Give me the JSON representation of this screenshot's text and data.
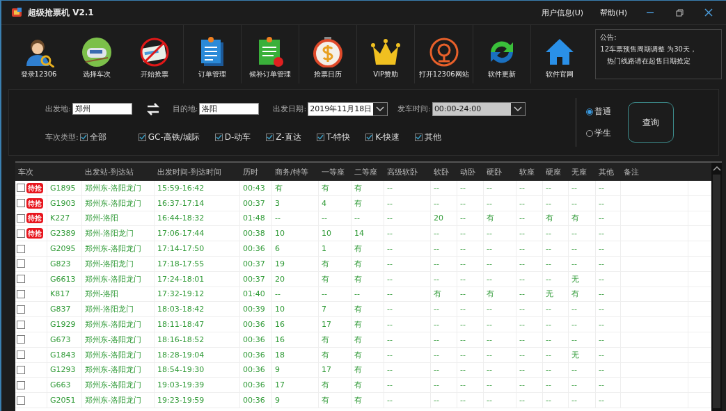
{
  "window": {
    "title": "超级抢票机 V2.1",
    "menu": [
      "用户信息(U)",
      "帮助(H)"
    ]
  },
  "toolbar": [
    {
      "label": "登录12306"
    },
    {
      "label": "选择车次"
    },
    {
      "label": "开始抢票"
    },
    {
      "label": "订单管理"
    },
    {
      "label": "候补订单管理"
    },
    {
      "label": "抢票日历"
    },
    {
      "label": "VIP赞助"
    },
    {
      "label": "打开12306网站"
    },
    {
      "label": "软件更新"
    },
    {
      "label": "软件官网"
    }
  ],
  "notice": {
    "title": "公告:",
    "lines": [
      "12车票预售周期调整  为30天，",
      "热门线路请在起售日期抢定"
    ]
  },
  "search": {
    "from_label": "出发地:",
    "from": "郑州",
    "to_label": "目的地:",
    "to": "洛阳",
    "date_label": "出发日期:",
    "date": "2019年11月18日",
    "time_label": "发车时间:",
    "time": "00:00-24:00",
    "type_label": "车次类型:",
    "types": [
      {
        "label": "全部",
        "checked": true
      },
      {
        "label": "GC-高铁/城际",
        "checked": true
      },
      {
        "label": "D-动车",
        "checked": true
      },
      {
        "label": "Z-直达",
        "checked": true
      },
      {
        "label": "T-特快",
        "checked": true
      },
      {
        "label": "K-快速",
        "checked": true
      },
      {
        "label": "其他",
        "checked": true
      }
    ],
    "passenger": [
      {
        "label": "普通",
        "selected": true
      },
      {
        "label": "学生",
        "selected": false
      }
    ],
    "query_button": "查询"
  },
  "table": {
    "columns": [
      "车次",
      "出发站-到达站",
      "出发时间-到达时间",
      "历时",
      "商务/特等",
      "一等座",
      "二等座",
      "高级软卧",
      "软卧",
      "动卧",
      "硬卧",
      "软座",
      "硬座",
      "无座",
      "其他",
      "备注"
    ],
    "rows": [
      {
        "checked": false,
        "badge": "待抢",
        "train": "G1895",
        "stations": "郑州东-洛阳龙门",
        "times": "15:59-16:42",
        "duration": "00:43",
        "seats": [
          "有",
          "有",
          "有",
          "--",
          "--",
          "--",
          "--",
          "--",
          "--",
          "--",
          "--"
        ]
      },
      {
        "checked": false,
        "badge": "待抢",
        "train": "G1903",
        "stations": "郑州东-洛阳龙门",
        "times": "16:37-17:14",
        "duration": "00:37",
        "seats": [
          "3",
          "4",
          "有",
          "--",
          "--",
          "--",
          "--",
          "--",
          "--",
          "--",
          "--"
        ]
      },
      {
        "checked": false,
        "badge": "待抢",
        "train": "K227",
        "stations": "郑州-洛阳",
        "times": "16:44-18:32",
        "duration": "01:48",
        "seats": [
          "--",
          "--",
          "--",
          "--",
          "20",
          "--",
          "有",
          "--",
          "有",
          "有",
          "--"
        ]
      },
      {
        "checked": false,
        "badge": "待抢",
        "train": "G2389",
        "stations": "郑州-洛阳龙门",
        "times": "17:06-17:44",
        "duration": "00:38",
        "seats": [
          "10",
          "10",
          "14",
          "--",
          "--",
          "--",
          "--",
          "--",
          "--",
          "--",
          "--"
        ]
      },
      {
        "checked": false,
        "train": "G2095",
        "stations": "郑州东-洛阳龙门",
        "times": "17:14-17:50",
        "duration": "00:36",
        "seats": [
          "6",
          "1",
          "有",
          "--",
          "--",
          "--",
          "--",
          "--",
          "--",
          "--",
          "--"
        ]
      },
      {
        "checked": false,
        "train": "G823",
        "stations": "郑州-洛阳龙门",
        "times": "17:18-17:55",
        "duration": "00:37",
        "seats": [
          "19",
          "有",
          "有",
          "--",
          "--",
          "--",
          "--",
          "--",
          "--",
          "--",
          "--"
        ]
      },
      {
        "checked": false,
        "train": "G6613",
        "stations": "郑州东-洛阳龙门",
        "times": "17:24-18:01",
        "duration": "00:37",
        "seats": [
          "20",
          "有",
          "有",
          "--",
          "--",
          "--",
          "--",
          "--",
          "--",
          "无",
          "--"
        ]
      },
      {
        "checked": false,
        "train": "K817",
        "stations": "郑州-洛阳",
        "times": "17:32-19:12",
        "duration": "01:40",
        "seats": [
          "--",
          "--",
          "--",
          "--",
          "有",
          "--",
          "有",
          "--",
          "无",
          "有",
          "--"
        ]
      },
      {
        "checked": false,
        "train": "G837",
        "stations": "郑州-洛阳龙门",
        "times": "18:03-18:42",
        "duration": "00:39",
        "seats": [
          "10",
          "7",
          "有",
          "--",
          "--",
          "--",
          "--",
          "--",
          "--",
          "--",
          "--"
        ]
      },
      {
        "checked": false,
        "train": "G1929",
        "stations": "郑州东-洛阳龙门",
        "times": "18:11-18:47",
        "duration": "00:36",
        "seats": [
          "16",
          "17",
          "有",
          "--",
          "--",
          "--",
          "--",
          "--",
          "--",
          "--",
          "--"
        ]
      },
      {
        "checked": false,
        "train": "G673",
        "stations": "郑州东-洛阳龙门",
        "times": "18:16-18:52",
        "duration": "00:36",
        "seats": [
          "16",
          "有",
          "有",
          "--",
          "--",
          "--",
          "--",
          "--",
          "--",
          "--",
          "--"
        ]
      },
      {
        "checked": false,
        "train": "G1843",
        "stations": "郑州东-洛阳龙门",
        "times": "18:28-19:04",
        "duration": "00:36",
        "seats": [
          "18",
          "有",
          "有",
          "--",
          "--",
          "--",
          "--",
          "--",
          "--",
          "无",
          "--"
        ]
      },
      {
        "checked": false,
        "train": "G1293",
        "stations": "郑州东-洛阳龙门",
        "times": "18:54-19:30",
        "duration": "00:36",
        "seats": [
          "9",
          "17",
          "有",
          "--",
          "--",
          "--",
          "--",
          "--",
          "--",
          "--",
          "--"
        ]
      },
      {
        "checked": false,
        "train": "G663",
        "stations": "郑州东-洛阳龙门",
        "times": "19:03-19:39",
        "duration": "00:36",
        "seats": [
          "17",
          "有",
          "有",
          "--",
          "--",
          "--",
          "--",
          "--",
          "--",
          "--",
          "--"
        ]
      },
      {
        "checked": false,
        "train": "G2051",
        "stations": "郑州东-洛阳龙门",
        "times": "19:23-19:59",
        "duration": "00:36",
        "seats": [
          "9",
          "有",
          "有",
          "--",
          "--",
          "--",
          "--",
          "--",
          "--",
          "--",
          "--"
        ]
      }
    ]
  }
}
